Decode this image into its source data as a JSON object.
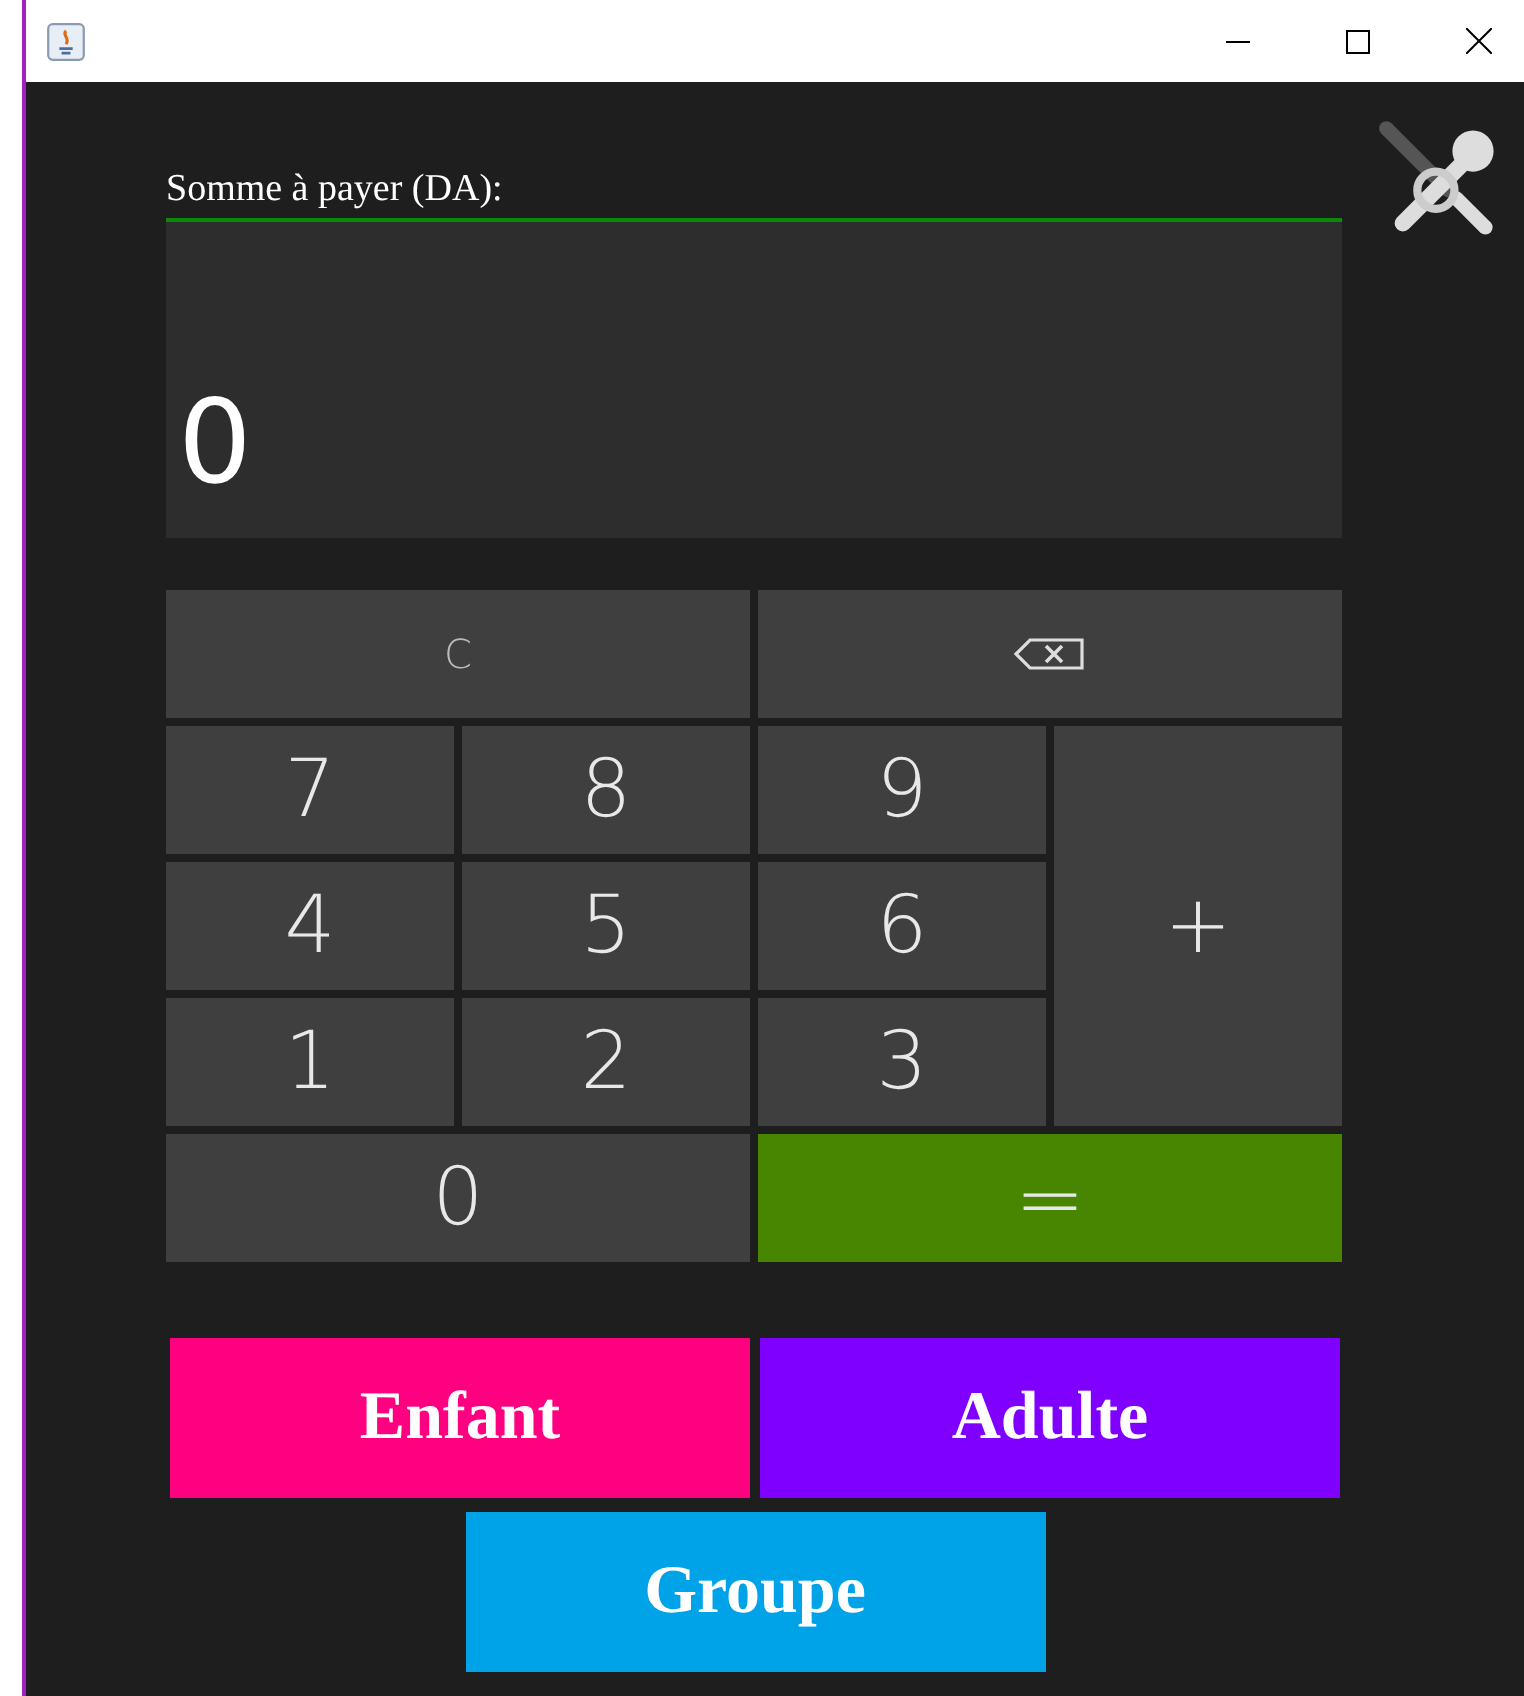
{
  "amount": {
    "label": "Somme à payer (DA):",
    "value": "0"
  },
  "keys": [
    {
      "kind": "clear",
      "label": "C"
    },
    {
      "kind": "backspace"
    },
    {
      "kind": "digit",
      "label": "7"
    },
    {
      "kind": "digit",
      "label": "8"
    },
    {
      "kind": "digit",
      "label": "9"
    },
    {
      "kind": "digit",
      "label": "4"
    },
    {
      "kind": "digit",
      "label": "5"
    },
    {
      "kind": "digit",
      "label": "6"
    },
    {
      "kind": "plus",
      "label": "+"
    },
    {
      "kind": "digit",
      "label": "1"
    },
    {
      "kind": "digit",
      "label": "2"
    },
    {
      "kind": "digit",
      "label": "3"
    },
    {
      "kind": "digit",
      "label": "0"
    },
    {
      "kind": "equals",
      "label": "="
    }
  ],
  "categories": [
    {
      "label": "Enfant",
      "color": "#ff0080"
    },
    {
      "label": "Adulte",
      "color": "#8000ff"
    },
    {
      "label": "Groupe",
      "color": "#00a2e8"
    }
  ]
}
